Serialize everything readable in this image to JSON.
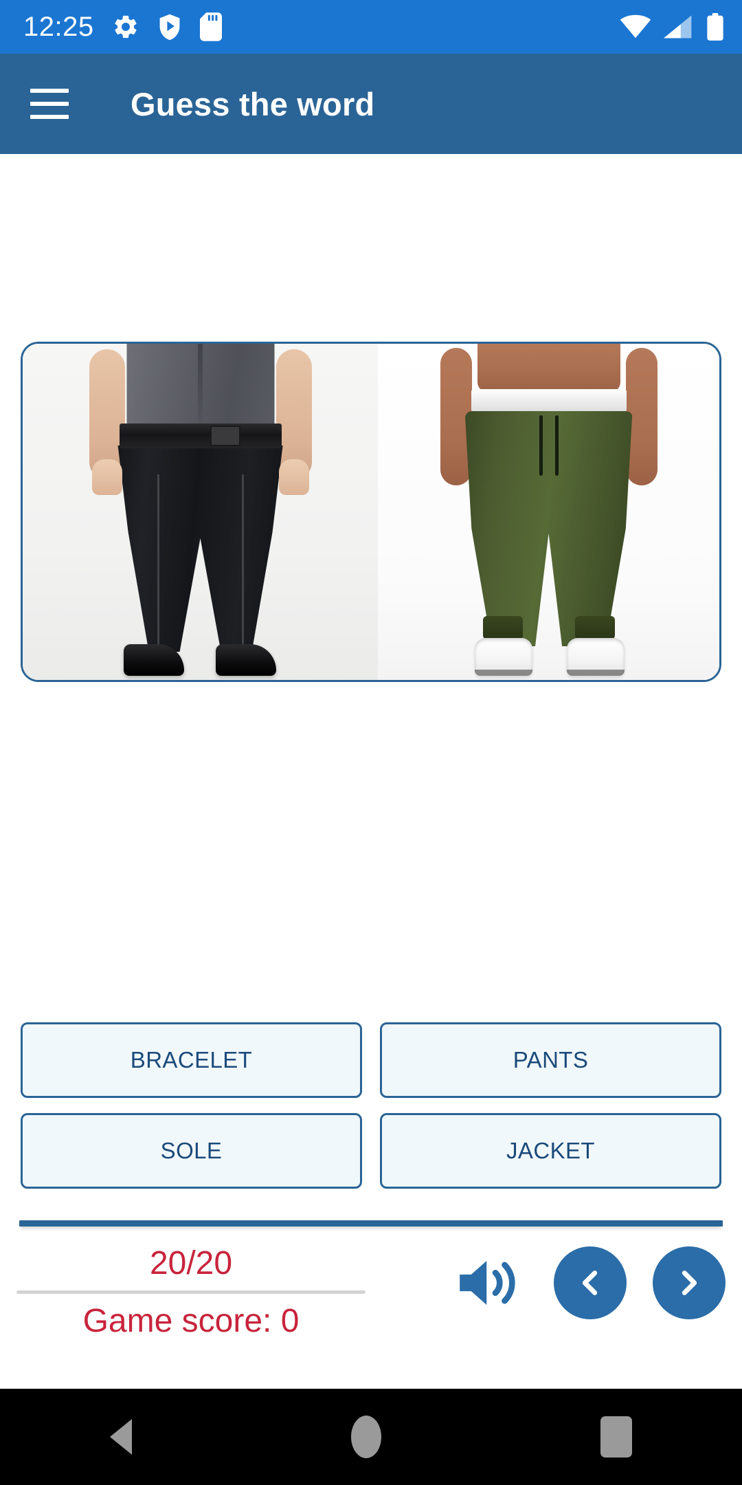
{
  "status_bar": {
    "time": "12:25",
    "icons_left": [
      "gear-icon",
      "shield-play-icon",
      "sd-card-icon"
    ],
    "icons_right": [
      "wifi-icon",
      "cellular-signal-icon",
      "battery-icon"
    ],
    "background_color": "#1b76d2"
  },
  "app_bar": {
    "menu_icon": "hamburger-menu-icon",
    "title": "Guess the word",
    "background_color": "#2a6496"
  },
  "question": {
    "image_description": "Two photographs side by side: a man wearing black dress pants with a belt and black shoes, and a man wearing olive green jogger pants with white sneakers",
    "card_border_color": "#2a6496"
  },
  "answers": {
    "options": [
      {
        "label": "BRACELET"
      },
      {
        "label": "PANTS"
      },
      {
        "label": "SOLE"
      },
      {
        "label": "JACKET"
      }
    ],
    "text_color": "#1a4a7a",
    "background_color": "#f1f8fb",
    "border_color": "#2a6496"
  },
  "footer": {
    "counter": "20/20",
    "game_score_label": "Game score:  0",
    "text_color": "#c8243c",
    "sound_button": "speaker-volume-icon",
    "previous_button": "chevron-left-icon",
    "next_button": "chevron-right-icon",
    "button_color": "#2a6da8"
  },
  "system_nav": {
    "back": "back-triangle-icon",
    "home": "home-circle-icon",
    "recents": "recents-square-icon"
  }
}
